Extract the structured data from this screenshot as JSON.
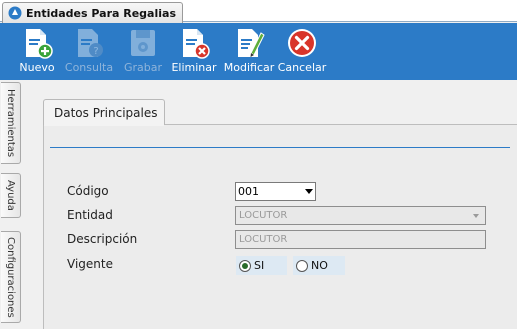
{
  "window": {
    "tab_title": "Entidades Para Regalias"
  },
  "toolbar": {
    "buttons": [
      {
        "label": "Nuevo",
        "icon": "new-document-icon",
        "enabled": true
      },
      {
        "label": "Consulta",
        "icon": "query-document-icon",
        "enabled": false
      },
      {
        "label": "Grabar",
        "icon": "save-disk-icon",
        "enabled": false
      },
      {
        "label": "Eliminar",
        "icon": "delete-document-icon",
        "enabled": true
      },
      {
        "label": "Modificar",
        "icon": "edit-document-icon",
        "enabled": true
      },
      {
        "label": "Cancelar",
        "icon": "cancel-icon",
        "enabled": true
      }
    ]
  },
  "side_tabs": [
    "Herramientas",
    "Ayuda",
    "Configuraciones"
  ],
  "panel": {
    "tab_label": "Datos Principales",
    "fields": {
      "codigo_label": "Código",
      "codigo_value": "001",
      "entidad_label": "Entidad",
      "entidad_value": "LOCUTOR",
      "descripcion_label": "Descripción",
      "descripcion_value": "LOCUTOR",
      "vigente_label": "Vigente",
      "vigente_options": [
        {
          "label": "SI",
          "selected": true
        },
        {
          "label": "NO",
          "selected": false
        }
      ]
    }
  },
  "colors": {
    "toolbar_bg": "#2c7bc7",
    "accent_rule": "#2c7bc7"
  }
}
